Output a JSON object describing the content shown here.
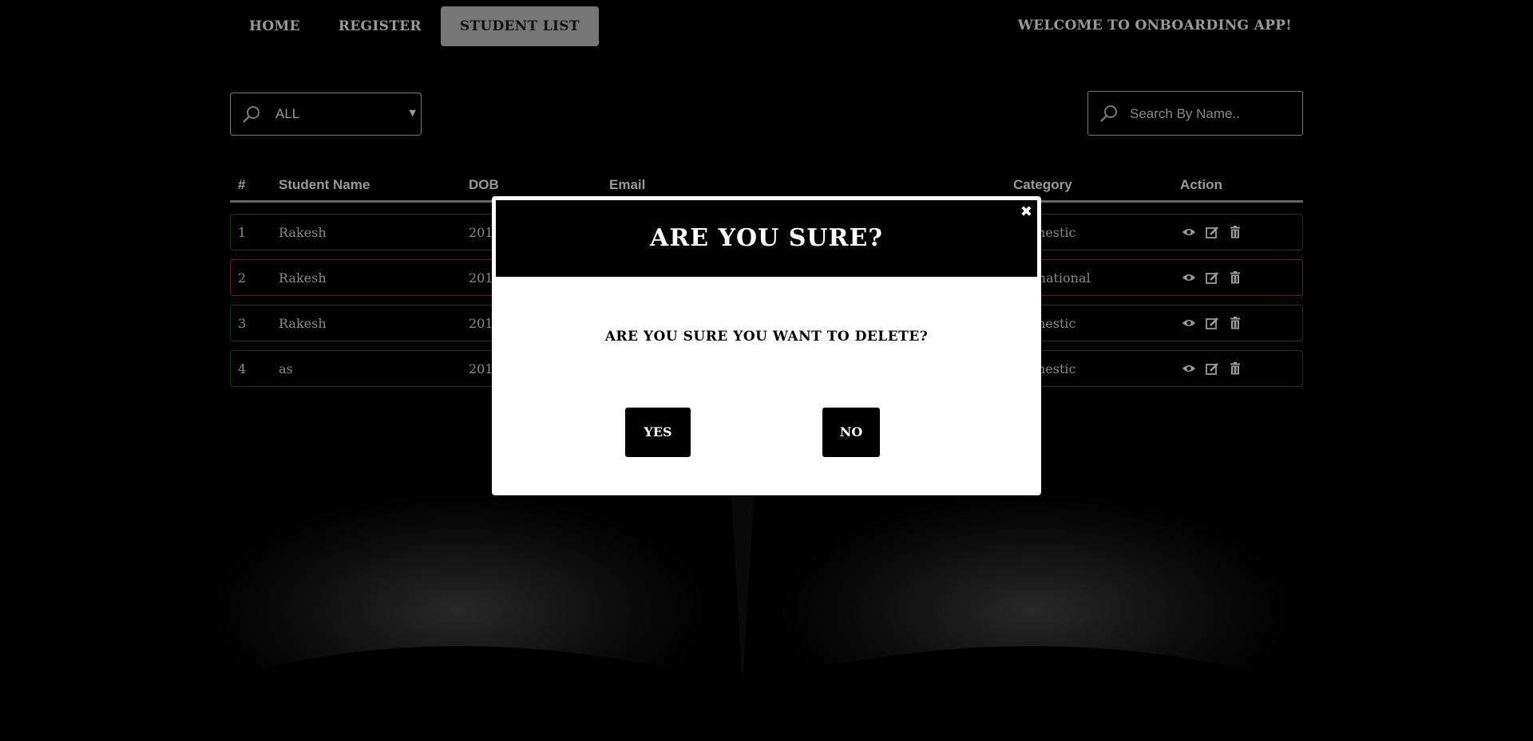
{
  "nav": {
    "items": [
      {
        "label": "HOME",
        "active": false
      },
      {
        "label": "REGISTER",
        "active": false
      },
      {
        "label": "STUDENT LIST",
        "active": true
      }
    ],
    "welcome": "WELCOME TO ONBOARDING APP!"
  },
  "filter": {
    "value": "ALL",
    "icon": "search-icon"
  },
  "search": {
    "placeholder": "Search By Name..",
    "icon": "search-icon"
  },
  "table": {
    "headers": [
      "#",
      "Student Name",
      "DOB",
      "Email",
      "Category",
      "Action"
    ],
    "rows": [
      {
        "num": "1",
        "name": "Rakesh",
        "dob": "201",
        "category": "nestic",
        "status_color": "#153a15"
      },
      {
        "num": "2",
        "name": "Rakesh",
        "dob": "201",
        "category": "rnational",
        "status_color": "#6a1c12"
      },
      {
        "num": "3",
        "name": "Rakesh",
        "dob": "201",
        "category": "nestic",
        "status_color": "#153a15"
      },
      {
        "num": "4",
        "name": "as",
        "dob": "201",
        "category": "nestic",
        "status_color": "#153a15"
      }
    ],
    "action_icons": [
      "eye-icon",
      "edit-icon",
      "trash-icon"
    ]
  },
  "modal": {
    "title": "ARE YOU SURE?",
    "message": "ARE YOU SURE YOU WANT TO DELETE?",
    "yes_label": "YES",
    "no_label": "NO",
    "close_icon": "close-icon"
  },
  "colors": {
    "background": "#000000",
    "active_tab": "#777777",
    "domestic_border": "#153a15",
    "international_border": "#6a1c12"
  }
}
